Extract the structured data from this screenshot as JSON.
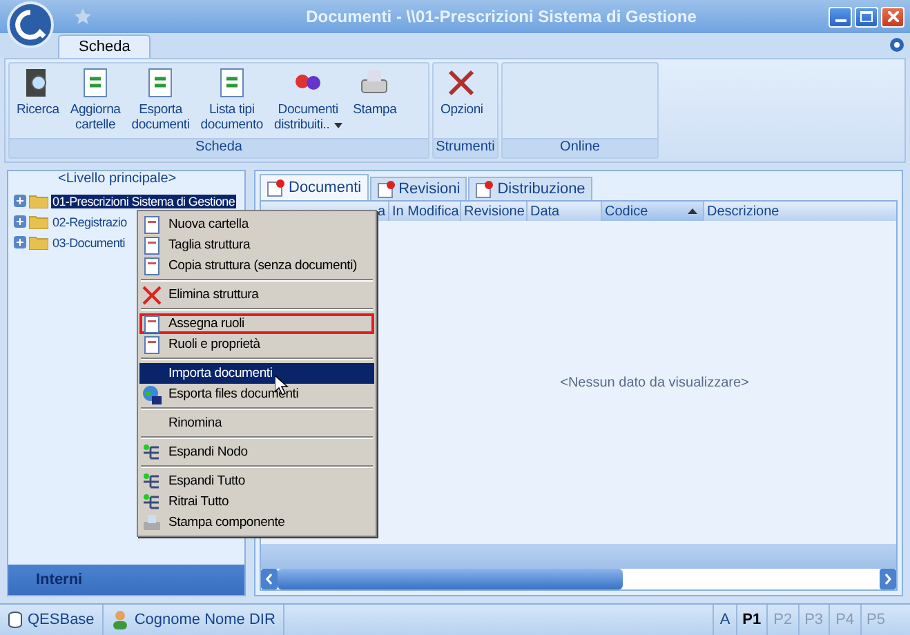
{
  "window": {
    "title": "Documenti - \\\\01-Prescrizioni Sistema di Gestione"
  },
  "ribbon_tabs": [
    {
      "label": "Scheda",
      "selected": true
    }
  ],
  "ribbon_groups": [
    {
      "label": "Scheda",
      "buttons": [
        {
          "label": "Ricerca",
          "dropdown": false
        },
        {
          "label": "Aggiorna\ncartelle",
          "dropdown": false
        },
        {
          "label": "Esporta\ndocumenti",
          "dropdown": false
        },
        {
          "label": "Lista tipi\ndocumento",
          "dropdown": false
        },
        {
          "label": "Documenti\ndistribuiti..",
          "dropdown": true
        },
        {
          "label": "Stampa",
          "dropdown": false
        }
      ]
    },
    {
      "label": "Strumenti",
      "buttons": [
        {
          "label": "Opzioni",
          "dropdown": false
        }
      ]
    },
    {
      "label": "Online"
    }
  ],
  "tree": {
    "root": "<Livello principale>",
    "items": [
      {
        "label": "01-Prescrizioni Sistema di Gestione",
        "selected": true,
        "expanded": false
      },
      {
        "label": "02-Registrazio",
        "selected": false,
        "expanded": false
      },
      {
        "label": "03-Documenti",
        "selected": false,
        "expanded": false
      }
    ]
  },
  "sidebar_section": "Interni",
  "doc_tabs": [
    {
      "label": "Documenti",
      "selected": true
    },
    {
      "label": "Revisioni",
      "selected": false
    },
    {
      "label": "Distribuzione",
      "selected": false
    }
  ],
  "table": {
    "columns": [
      {
        "label": "a",
        "sorted": false
      },
      {
        "label": "In Modifica",
        "sorted": false
      },
      {
        "label": "Revisione",
        "sorted": false
      },
      {
        "label": "Data",
        "sorted": false
      },
      {
        "label": "Codice",
        "sorted": true
      },
      {
        "label": "Descrizione",
        "sorted": false
      }
    ],
    "empty_message": "<Nessun dato da visualizzare>"
  },
  "context_menu": [
    {
      "kind": "item",
      "label": "Nuova cartella",
      "selected": false,
      "outlined": false
    },
    {
      "kind": "item",
      "label": "Taglia struttura",
      "selected": false,
      "outlined": false
    },
    {
      "kind": "item",
      "label": "Copia struttura (senza documenti)",
      "selected": false,
      "outlined": false
    },
    {
      "kind": "separator"
    },
    {
      "kind": "item",
      "label": "Elimina struttura",
      "selected": false,
      "outlined": false
    },
    {
      "kind": "separator"
    },
    {
      "kind": "item",
      "label": "Assegna ruoli",
      "selected": false,
      "outlined": true
    },
    {
      "kind": "item",
      "label": "Ruoli e proprietà",
      "selected": false,
      "outlined": false
    },
    {
      "kind": "separator"
    },
    {
      "kind": "item",
      "label": "Importa documenti",
      "selected": true,
      "outlined": false
    },
    {
      "kind": "item",
      "label": "Esporta files documenti",
      "selected": false,
      "outlined": false
    },
    {
      "kind": "separator"
    },
    {
      "kind": "item",
      "label": "Rinomina",
      "selected": false,
      "outlined": false
    },
    {
      "kind": "separator"
    },
    {
      "kind": "item",
      "label": "Espandi Nodo",
      "selected": false,
      "outlined": false
    },
    {
      "kind": "separator"
    },
    {
      "kind": "item",
      "label": "Espandi Tutto",
      "selected": false,
      "outlined": false
    },
    {
      "kind": "item",
      "label": "Ritrai Tutto",
      "selected": false,
      "outlined": false
    },
    {
      "kind": "item",
      "label": "Stampa componente",
      "selected": false,
      "outlined": false
    }
  ],
  "status_bar": {
    "items": [
      "QESBase",
      "Cognome Nome DIR"
    ],
    "pages": [
      {
        "label": "A",
        "disabled": false,
        "selected": false
      },
      {
        "label": "P1",
        "disabled": false,
        "selected": true
      },
      {
        "label": "P2",
        "disabled": true,
        "selected": false
      },
      {
        "label": "P3",
        "disabled": true,
        "selected": false
      },
      {
        "label": "P4",
        "disabled": true,
        "selected": false
      },
      {
        "label": "P5",
        "disabled": true,
        "selected": false
      }
    ]
  }
}
